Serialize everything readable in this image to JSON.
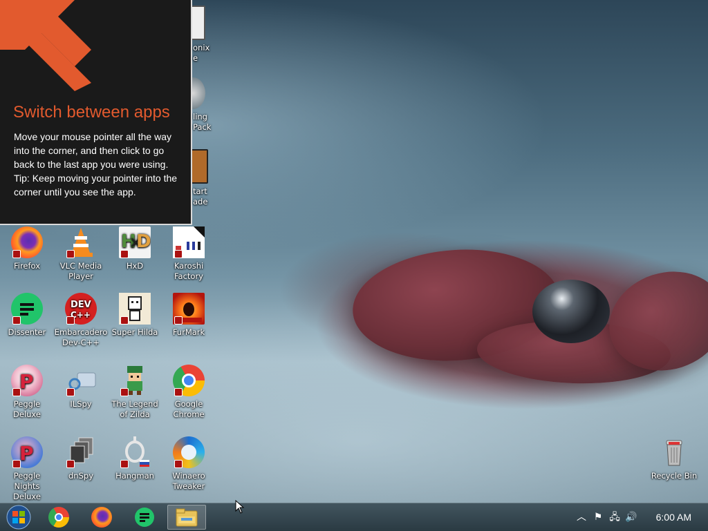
{
  "tip": {
    "title": "Switch between apps",
    "body_line1": "Move your mouse pointer all the way into the corner, and then click to go back to the last app you were using.",
    "body_line2": "Tip: Keep moving your pointer into the corner until you see the app."
  },
  "desktop": {
    "partial_icons": [
      "onix\ne",
      "ling\nPack",
      "tart\nade"
    ],
    "icons": [
      {
        "label": "Firefox"
      },
      {
        "label": "VLC Media Player"
      },
      {
        "label": "HxD"
      },
      {
        "label": "Karoshi Factory"
      },
      {
        "label": "Dissenter"
      },
      {
        "label": "Embarcadero Dev-C++"
      },
      {
        "label": "Super Hilda"
      },
      {
        "label": "FurMark"
      },
      {
        "label": "Peggle Deluxe"
      },
      {
        "label": "ILSpy"
      },
      {
        "label": "The Legend of Zilda"
      },
      {
        "label": "Google Chrome"
      },
      {
        "label": "Peggle Nights Deluxe"
      },
      {
        "label": "dnSpy"
      },
      {
        "label": "Hangman"
      },
      {
        "label": "Winaero Tweaker"
      },
      {
        "label": "Recycle Bin"
      }
    ]
  },
  "taskbar": {
    "clock": "6:00 AM",
    "buttons": [
      "start-orb-icon",
      "chrome-icon",
      "firefox-icon",
      "dissenter-icon",
      "file-explorer-icon"
    ]
  },
  "colors": {
    "tip_title": "#e25a2e",
    "tip_background": "#1a1a1a",
    "taskbar": "#2f3f47"
  }
}
